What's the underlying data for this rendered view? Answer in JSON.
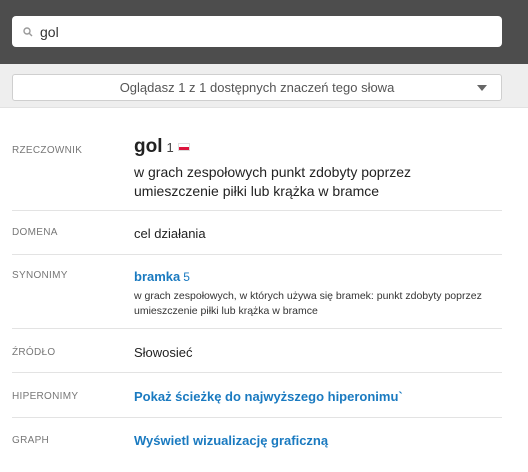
{
  "search": {
    "value": "gol",
    "placeholder": ""
  },
  "meaning_selector": {
    "label": "Oglądasz 1 z 1 dostępnych znaczeń tego słowa"
  },
  "entry": {
    "pos_label": "RZECZOWNIK",
    "word": "gol",
    "sense_number": "1",
    "definition": "w grach zespołowych punkt zdobyty poprzez umieszczenie piłki lub krążka w bramce"
  },
  "domain": {
    "label": "DOMENA",
    "value": "cel działania"
  },
  "synonyms": {
    "label": "SYNONIMY",
    "items": [
      {
        "word": "bramka",
        "number": "5",
        "definition": "w grach zespołowych, w których używa się bramek: punkt zdobyty poprzez umieszczenie piłki lub krążka w bramce"
      }
    ]
  },
  "source": {
    "label": "ŹRÓDŁO",
    "value": "Słowosieć"
  },
  "hypernyms": {
    "label": "HIPERONIMY",
    "link": "Pokaż ścieżkę do najwyższego hiperonimu`"
  },
  "graph": {
    "label": "GRAPH",
    "link": "Wyświetl wizualizację graficzną"
  }
}
